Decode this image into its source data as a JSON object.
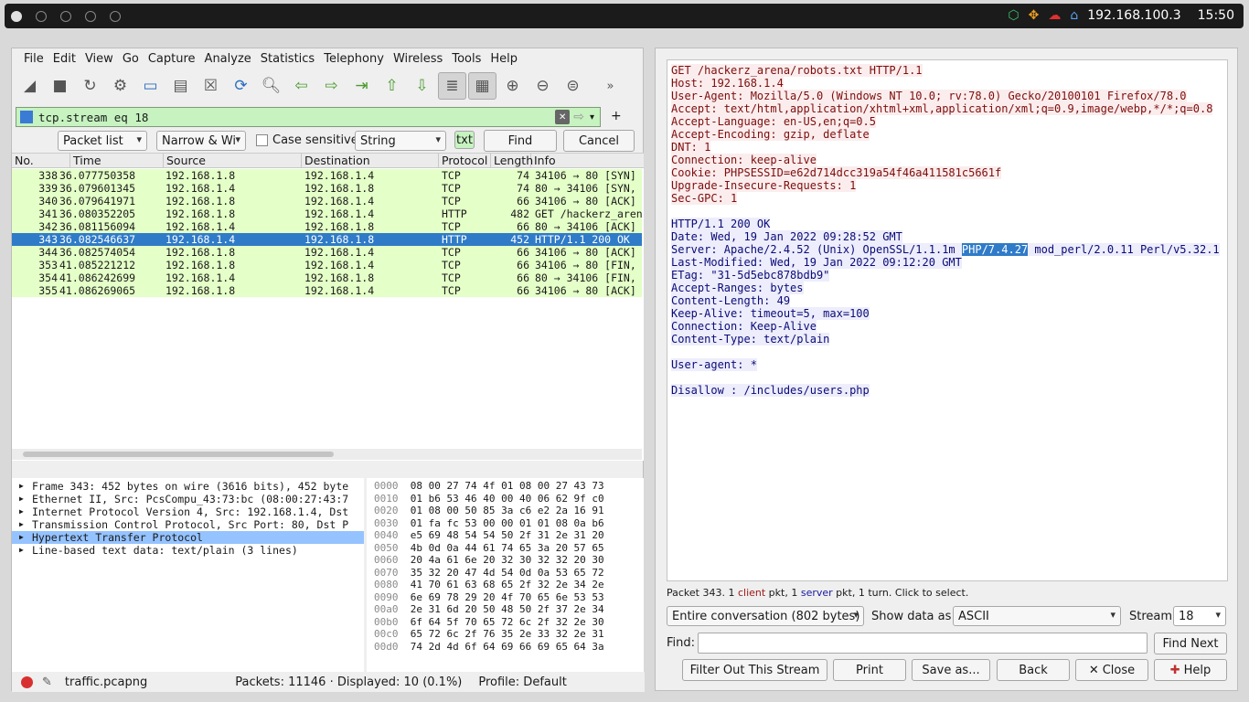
{
  "topbar": {
    "ip": "192.168.100.3",
    "time": "15:50"
  },
  "wireshark": {
    "menu": [
      "File",
      "Edit",
      "View",
      "Go",
      "Capture",
      "Analyze",
      "Statistics",
      "Telephony",
      "Wireless",
      "Tools",
      "Help"
    ],
    "filter": "tcp.stream eq 18",
    "find": {
      "target": "Packet list",
      "charset": "Narrow & Wi",
      "case": "Case sensitive",
      "type": "String",
      "txt": "txt",
      "find_btn": "Find",
      "cancel_btn": "Cancel"
    },
    "columns": [
      "No.",
      "Time",
      "Source",
      "Destination",
      "Protocol",
      "Length",
      "Info"
    ],
    "packets": [
      {
        "no": "338",
        "time": "36.077750358",
        "src": "192.168.1.8",
        "dst": "192.168.1.4",
        "proto": "TCP",
        "len": "74",
        "info": "34106 → 80 [SYN]"
      },
      {
        "no": "339",
        "time": "36.079601345",
        "src": "192.168.1.4",
        "dst": "192.168.1.8",
        "proto": "TCP",
        "len": "74",
        "info": "80 → 34106 [SYN,"
      },
      {
        "no": "340",
        "time": "36.079641971",
        "src": "192.168.1.8",
        "dst": "192.168.1.4",
        "proto": "TCP",
        "len": "66",
        "info": "34106 → 80 [ACK]"
      },
      {
        "no": "341",
        "time": "36.080352205",
        "src": "192.168.1.8",
        "dst": "192.168.1.4",
        "proto": "HTTP",
        "len": "482",
        "info": "GET /hackerz_aren"
      },
      {
        "no": "342",
        "time": "36.081156094",
        "src": "192.168.1.4",
        "dst": "192.168.1.8",
        "proto": "TCP",
        "len": "66",
        "info": "80 → 34106 [ACK]"
      },
      {
        "no": "343",
        "time": "36.082546637",
        "src": "192.168.1.4",
        "dst": "192.168.1.8",
        "proto": "HTTP",
        "len": "452",
        "info": "HTTP/1.1 200 OK"
      },
      {
        "no": "344",
        "time": "36.082574054",
        "src": "192.168.1.8",
        "dst": "192.168.1.4",
        "proto": "TCP",
        "len": "66",
        "info": "34106 → 80 [ACK]"
      },
      {
        "no": "353",
        "time": "41.085221212",
        "src": "192.168.1.8",
        "dst": "192.168.1.4",
        "proto": "TCP",
        "len": "66",
        "info": "34106 → 80 [FIN,"
      },
      {
        "no": "354",
        "time": "41.086242699",
        "src": "192.168.1.4",
        "dst": "192.168.1.8",
        "proto": "TCP",
        "len": "66",
        "info": "80 → 34106 [FIN,"
      },
      {
        "no": "355",
        "time": "41.086269065",
        "src": "192.168.1.8",
        "dst": "192.168.1.4",
        "proto": "TCP",
        "len": "66",
        "info": "34106 → 80 [ACK]"
      }
    ],
    "details": [
      "Frame 343: 452 bytes on wire (3616 bits), 452 byte",
      "Ethernet II, Src: PcsCompu_43:73:bc (08:00:27:43:7",
      "Internet Protocol Version 4, Src: 192.168.1.4, Dst",
      "Transmission Control Protocol, Src Port: 80, Dst P",
      "Hypertext Transfer Protocol",
      "Line-based text data: text/plain (3 lines)"
    ],
    "hex": [
      {
        "off": "0000",
        "bytes": "08 00 27 74 4f 01 08 00  27 43 73"
      },
      {
        "off": "0010",
        "bytes": "01 b6 53 46 40 00 40 06  62 9f c0"
      },
      {
        "off": "0020",
        "bytes": "01 08 00 50 85 3a c6 e2  2a 16 91"
      },
      {
        "off": "0030",
        "bytes": "01 fa fc 53 00 00 01 01  08 0a b6"
      },
      {
        "off": "0040",
        "bytes": "e5 69 48 54 54 50 2f 31  2e 31 20"
      },
      {
        "off": "0050",
        "bytes": "4b 0d 0a 44 61 74 65 3a  20 57 65"
      },
      {
        "off": "0060",
        "bytes": "20 4a 61 6e 20 32 30 32  32 20 30"
      },
      {
        "off": "0070",
        "bytes": "35 32 20 47 4d 54 0d 0a  53 65 72"
      },
      {
        "off": "0080",
        "bytes": "41 70 61 63 68 65 2f 32  2e 34 2e"
      },
      {
        "off": "0090",
        "bytes": "6e 69 78 29 20 4f 70 65  6e 53 53"
      },
      {
        "off": "00a0",
        "bytes": "2e 31 6d 20 50 48 50 2f  37 2e 34"
      },
      {
        "off": "00b0",
        "bytes": "6f 64 5f 70 65 72 6c 2f  32 2e 30"
      },
      {
        "off": "00c0",
        "bytes": "65 72 6c 2f 76 35 2e 33  32 2e 31"
      },
      {
        "off": "00d0",
        "bytes": "74 2d 4d 6f 64 69 66 69  65 64 3a"
      }
    ],
    "status": {
      "file": "traffic.pcapng",
      "packets": "Packets: 11146 · Displayed: 10 (0.1%)",
      "profile": "Profile: Default"
    }
  },
  "follow": {
    "client_lines": [
      "GET /hackerz_arena/robots.txt HTTP/1.1",
      "Host: 192.168.1.4",
      "User-Agent: Mozilla/5.0 (Windows NT 10.0; rv:78.0) Gecko/20100101 Firefox/78.0",
      "Accept: text/html,application/xhtml+xml,application/xml;q=0.9,image/webp,*/*;q=0.8",
      "Accept-Language: en-US,en;q=0.5",
      "Accept-Encoding: gzip, deflate",
      "DNT: 1",
      "Connection: keep-alive",
      "Cookie: PHPSESSID=e62d714dcc319a54f46a411581c5661f",
      "Upgrade-Insecure-Requests: 1",
      "Sec-GPC: 1"
    ],
    "server_lines": [
      "HTTP/1.1 200 OK",
      "Date: Wed, 19 Jan 2022 09:28:52 GMT",
      "SERVER_LINE",
      "Last-Modified: Wed, 19 Jan 2022 09:12:20 GMT",
      "ETag: \"31-5d5ebc878bdb9\"",
      "Accept-Ranges: bytes",
      "Content-Length: 49",
      "Keep-Alive: timeout=5, max=100",
      "Connection: Keep-Alive",
      "Content-Type: text/plain"
    ],
    "server_pre": "Server: Apache/2.4.52 (Unix) OpenSSL/1.1.1m ",
    "server_hl": "PHP/7.4.27",
    "server_post": " mod_perl/2.0.11 Perl/v5.32.1",
    "body1": "User-agent: *",
    "body2": "Disallow : /includes/users.php",
    "info_pre": "Packet 343. 1 ",
    "info_client": "client",
    "info_mid": " pkt, 1 ",
    "info_server": "server",
    "info_post": " pkt, 1 turn. Click to select.",
    "conversation": "Entire conversation (802 bytes)",
    "show_as_label": "Show data as",
    "show_as": "ASCII",
    "stream_label": "Stream",
    "stream": "18",
    "find_label": "Find:",
    "find_next": "Find Next",
    "buttons": [
      "Filter Out This Stream",
      "Print",
      "Save as...",
      "Back",
      "Close",
      "Help"
    ]
  }
}
